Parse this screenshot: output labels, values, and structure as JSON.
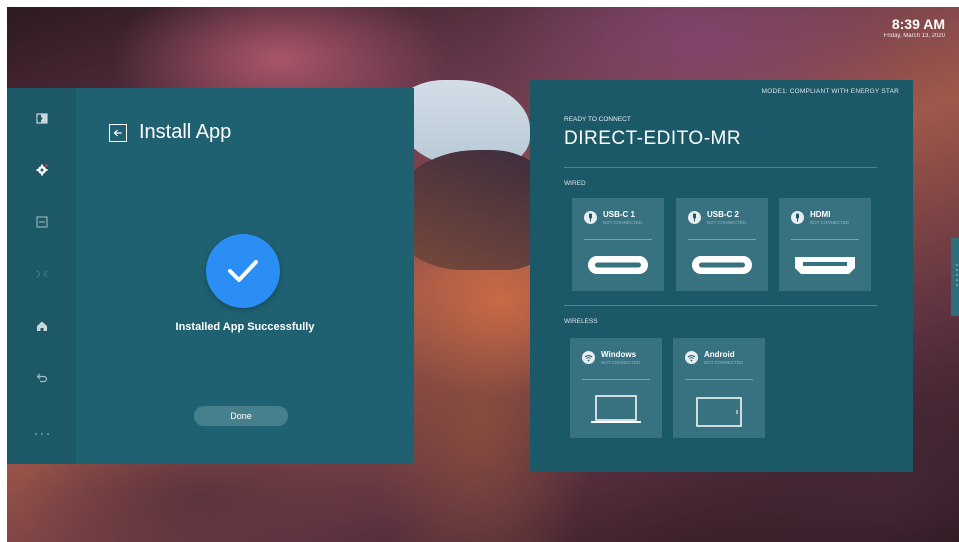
{
  "clock": {
    "time": "8:39 AM",
    "date": "Friday, March 13, 2020"
  },
  "sidebar": {
    "items": [
      {
        "name": "sign-in",
        "icon": "login-icon"
      },
      {
        "name": "settings",
        "icon": "gear-icon"
      },
      {
        "name": "whiteboard",
        "icon": "note-icon"
      },
      {
        "name": "screen-share",
        "icon": "cast-icon"
      },
      {
        "name": "home",
        "icon": "home-icon"
      },
      {
        "name": "back",
        "icon": "back-arrow-icon"
      },
      {
        "name": "more",
        "icon": "more-dots-icon"
      }
    ]
  },
  "install": {
    "title": "Install App",
    "message": "Installed App Successfully",
    "done_label": "Done"
  },
  "connect": {
    "mode_text": "MODE1: COMPLIANT WITH ENERGY STAR",
    "ready_label": "READY TO CONNECT",
    "device_name": "DIRECT-EDITO-MR",
    "wired_label": "WIRED",
    "wireless_label": "WIRELESS",
    "wired": [
      {
        "name": "USB-C 1",
        "status": "NOT CONNECTED",
        "icon": "usb-plug-icon",
        "graphic": "usb-c-port"
      },
      {
        "name": "USB-C 2",
        "status": "NOT CONNECTED",
        "icon": "usb-plug-icon",
        "graphic": "usb-c-port"
      },
      {
        "name": "HDMI",
        "status": "NOT CONNECTED",
        "icon": "usb-plug-icon",
        "graphic": "hdmi-port"
      }
    ],
    "wireless": [
      {
        "name": "Windows",
        "status": "NOT CONNECTED",
        "icon": "wifi-icon",
        "graphic": "laptop"
      },
      {
        "name": "Android",
        "status": "NOT CONNECTED",
        "icon": "wifi-icon",
        "graphic": "tablet"
      }
    ]
  },
  "colors": {
    "panel": "#1f6171",
    "sidebar": "#1d5867",
    "card": "#38717f",
    "accent": "#2b8ef4"
  }
}
